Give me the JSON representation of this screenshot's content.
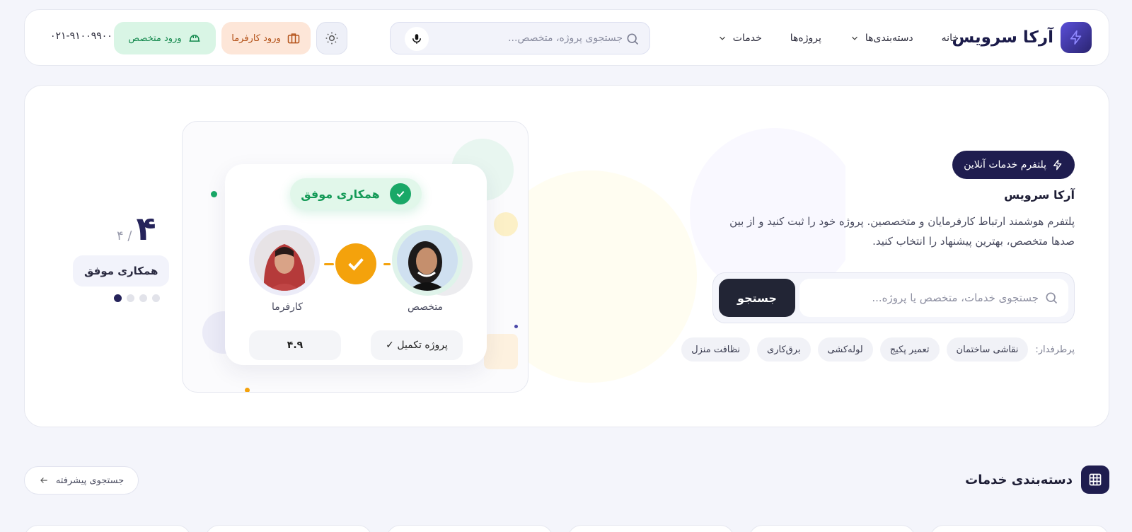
{
  "header": {
    "brand": "آرکا سرویس",
    "nav": [
      {
        "label": "خانه",
        "dropdown": false
      },
      {
        "label": "دسته‌بندی‌ها",
        "dropdown": true
      },
      {
        "label": "پروژه‌ها",
        "dropdown": false
      },
      {
        "label": "خدمات",
        "dropdown": true
      }
    ],
    "search_placeholder": "جستجوی پروژه، متخصص...",
    "employer_login": "ورود کارفرما",
    "expert_login": "ورود متخصص",
    "phone": "۰۲۱-۹۱۰۰۹۹۰۰"
  },
  "hero": {
    "badge": "پلتفرم خدمات آنلاین",
    "title": "آرکا سرویس",
    "description": "پلتفرم هوشمند ارتباط کارفرمایان و متخصصین. پروژه خود را ثبت کنید و از بین صدها متخصص، بهترین پیشنهاد را انتخاب کنید.",
    "search_placeholder": "جستجوی خدمات، متخصص یا پروژه...",
    "search_button": "جستجو",
    "popular_label": "پرطرفدار:",
    "popular": [
      "نقاشی ساختمان",
      "تعمیر پکیج",
      "لوله‌کشی",
      "برق‌کاری",
      "نظافت منزل"
    ]
  },
  "illustration": {
    "success": "همکاری موفق",
    "expert_label": "متخصص",
    "employer_label": "کارفرما",
    "project_done": "پروژه تکمیل ✓",
    "rating": "۴.۹"
  },
  "slider": {
    "current": "۴",
    "total": "۴ /",
    "label": "همکاری موفق",
    "dot_count": 4,
    "active_index": 0
  },
  "section": {
    "title": "دسته‌بندی خدمات",
    "advanced_search": "جستجوی پیشرفته"
  },
  "colors": {
    "brand_dark": "#1f1d4f",
    "success": "#19a867",
    "accent_orange": "#f4a20c",
    "employer_bg": "#fde6d8",
    "expert_bg": "#d9f5e5"
  }
}
